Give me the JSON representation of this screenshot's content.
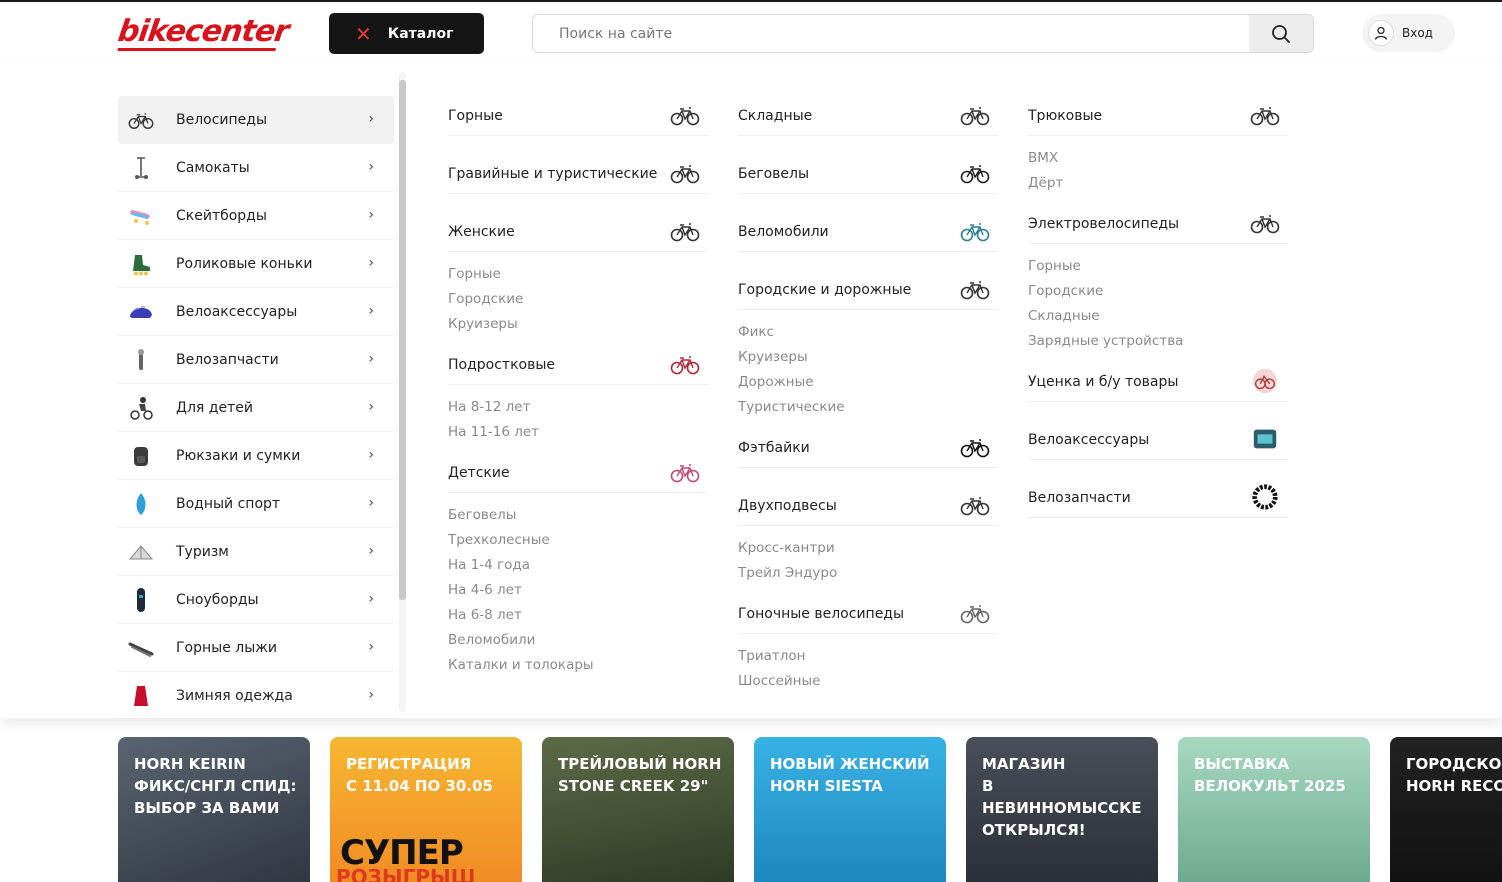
{
  "header": {
    "logo_text": "bikecenter",
    "catalog_label": "Каталог",
    "search_placeholder": "Поиск на сайте",
    "login_label": "Вход"
  },
  "sidebar": {
    "items": [
      {
        "label": "Велосипеды",
        "icon": "bicycle-icon"
      },
      {
        "label": "Самокаты",
        "icon": "scooter-icon"
      },
      {
        "label": "Скейтборды",
        "icon": "skateboard-icon"
      },
      {
        "label": "Роликовые коньки",
        "icon": "rollerskate-icon"
      },
      {
        "label": "Велоаксессуары",
        "icon": "helmet-icon"
      },
      {
        "label": "Велозапчасти",
        "icon": "bike-part-icon"
      },
      {
        "label": "Для детей",
        "icon": "kids-icon"
      },
      {
        "label": "Рюкзаки и сумки",
        "icon": "backpack-icon"
      },
      {
        "label": "Водный спорт",
        "icon": "water-sport-icon"
      },
      {
        "label": "Туризм",
        "icon": "tent-icon"
      },
      {
        "label": "Сноуборды",
        "icon": "snowboard-icon"
      },
      {
        "label": "Горные лыжи",
        "icon": "ski-icon"
      },
      {
        "label": "Зимняя одежда",
        "icon": "winter-clothes-icon"
      }
    ]
  },
  "columns": {
    "col1": {
      "gornye": "Горные",
      "graviynye": "Гравийные и туристические",
      "zhenskie": {
        "title": "Женские",
        "subs": [
          "Горные",
          "Городские",
          "Круизеры"
        ]
      },
      "podrostkovye": {
        "title": "Подростковые",
        "subs": [
          "На 8-12 лет",
          "На 11-16 лет"
        ]
      },
      "detskie": {
        "title": "Детские",
        "subs": [
          "Беговелы",
          "Трехколесные",
          "На 1-4 года",
          "На 4-6 лет",
          "На 6-8 лет",
          "Веломобили",
          "Каталки и толокары"
        ]
      }
    },
    "col2": {
      "skladnye": "Складные",
      "begovely": "Беговелы",
      "velomobili": "Веломобили",
      "gorodskie": {
        "title": "Городские и дорожные",
        "subs": [
          "Фикс",
          "Круизеры",
          "Дорожные",
          "Туристические"
        ]
      },
      "fatbikes": "Фэтбайки",
      "dvuhpodvesy": {
        "title": "Двухподвесы",
        "subs": [
          "Кросс-кантри",
          "Трейл Эндуро"
        ]
      },
      "gonochnye": {
        "title": "Гоночные велосипеды",
        "subs": [
          "Триатлон",
          "Шоссейные"
        ]
      }
    },
    "col3": {
      "tryukovye": {
        "title": "Трюковые",
        "subs": [
          "BMX",
          "Дёрт"
        ]
      },
      "elektro": {
        "title": "Электровелосипеды",
        "subs": [
          "Горные",
          "Городские",
          "Складные",
          "Зарядные устройства"
        ]
      },
      "utsenka": "Уценка и б/у товары",
      "veloaksessuary": "Велоаксессуары",
      "velozapchasti": "Велозапчасти"
    }
  },
  "banners": [
    {
      "text": "HORH KEIRIN\nФИКС/СНГЛ СПИД:\nВЫБОР ЗА ВАМИ",
      "bg": "#4a5563"
    },
    {
      "text": "РЕГИСТРАЦИЯ\nС 11.04 ПО 30.05",
      "bg": "#f5a623",
      "extra": "СУПЕР",
      "extra2": "РОЗЫГРЫШ"
    },
    {
      "text": "ТРЕЙЛОВЫЙ HORH\nSTONE CREEK 29\"",
      "bg": "#4b5a3a"
    },
    {
      "text": "НОВЫЙ ЖЕНСКИЙ\nHORH SIESTA",
      "bg": "#2fa3d6"
    },
    {
      "text": "МАГАЗИН\nВ НЕВИННОМЫССКЕ\nОТКРЫЛСЯ!",
      "bg": "#3a3f4a"
    },
    {
      "text": "ВЫСТАВКА\nВЕЛОКУЛЬТ 2025",
      "bg": "#8fc7ae"
    },
    {
      "text": "ГОРОДСКОЙ\nHORH RECO",
      "bg": "#1b1b1b"
    }
  ],
  "colors": {
    "brand_red": "#d8131b",
    "catalog_bg": "#151515"
  }
}
